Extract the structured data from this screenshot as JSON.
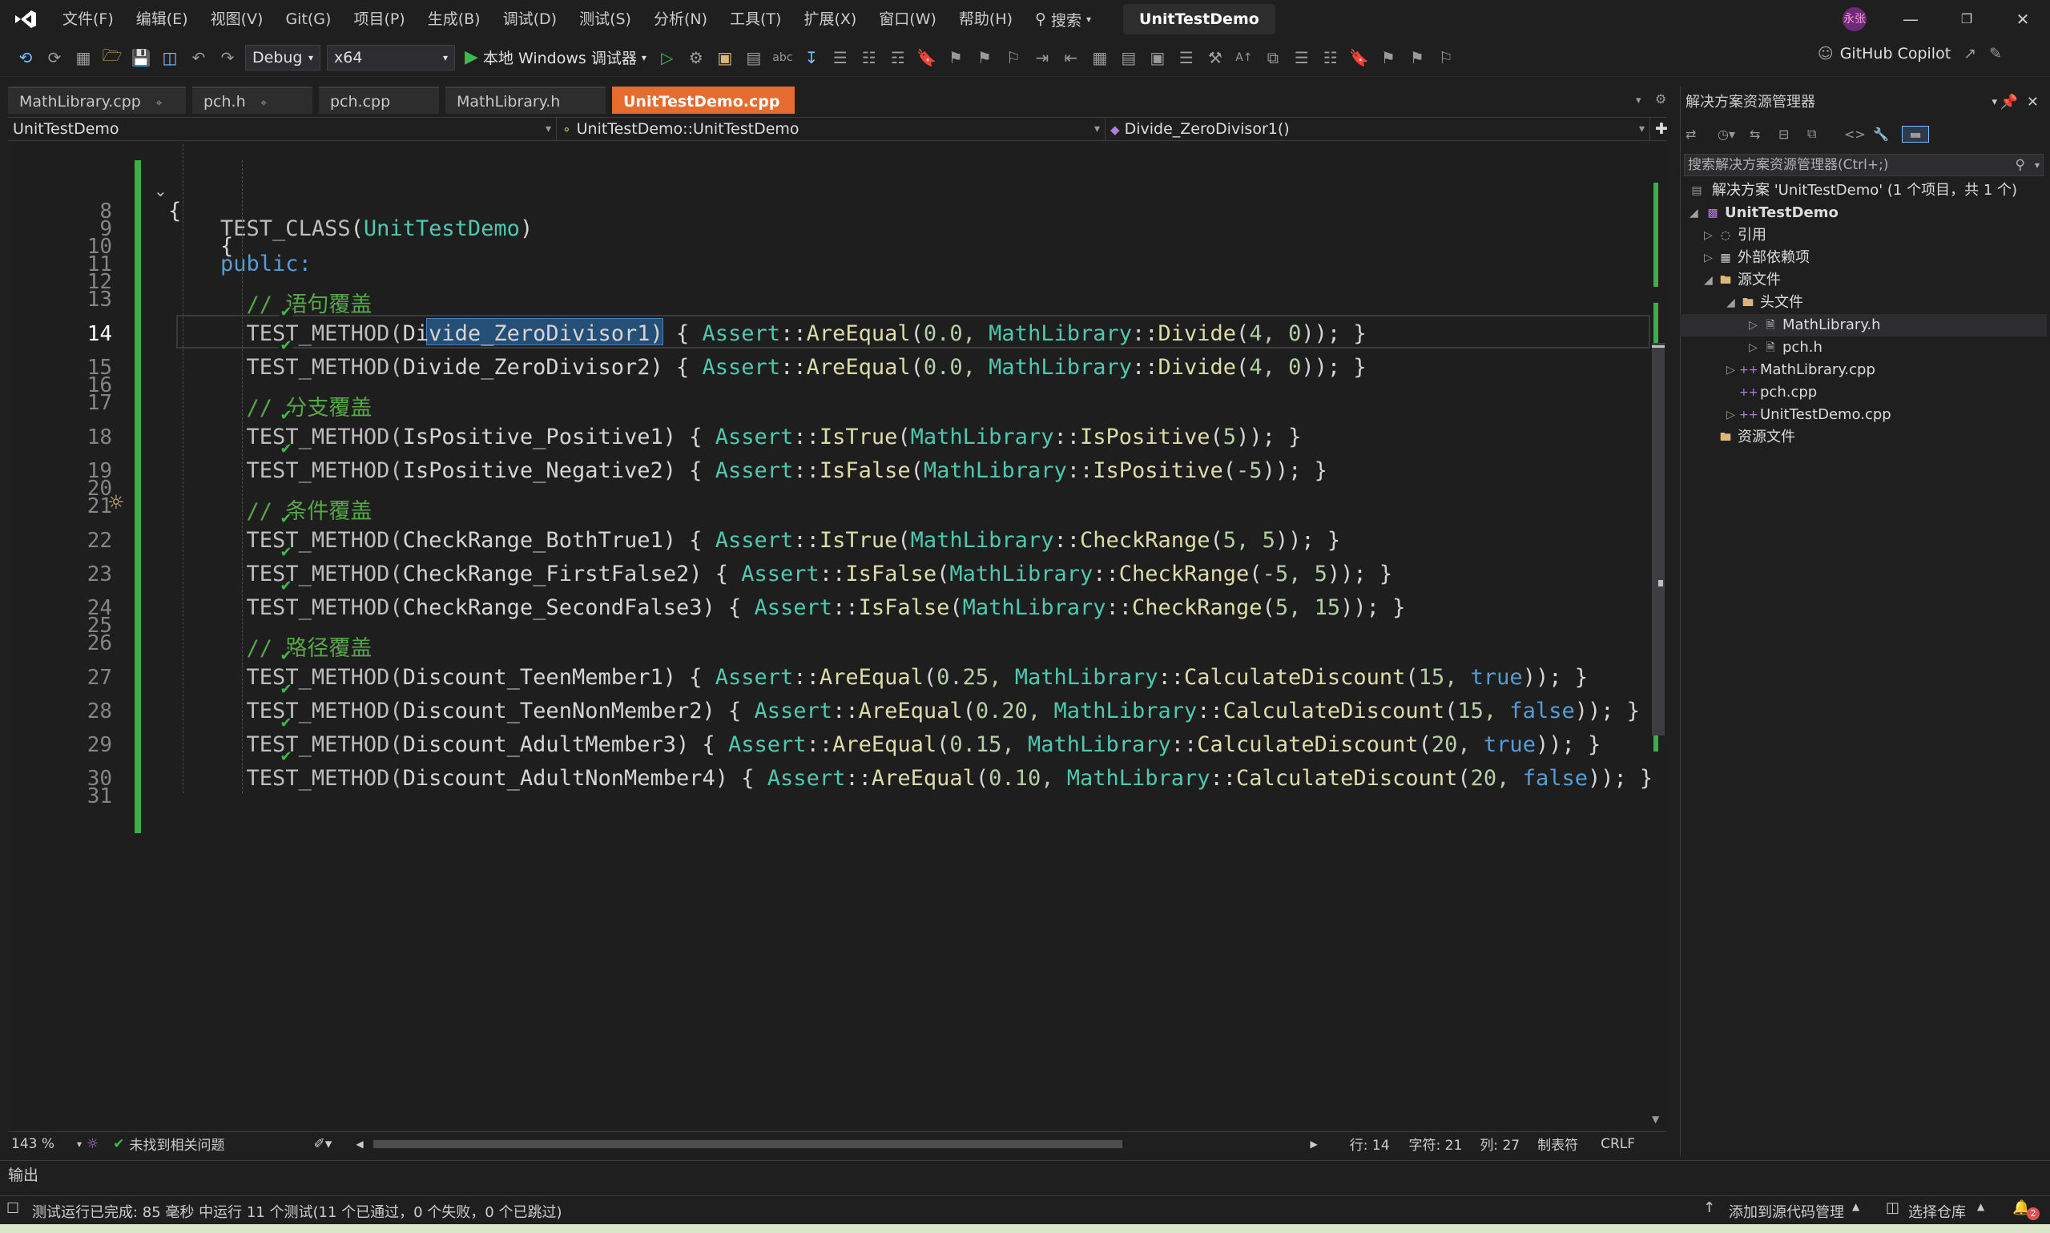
{
  "menubar": {
    "items": [
      "文件(F)",
      "编辑(E)",
      "视图(V)",
      "Git(G)",
      "项目(P)",
      "生成(B)",
      "调试(D)",
      "测试(S)",
      "分析(N)",
      "工具(T)",
      "扩展(X)",
      "窗口(W)",
      "帮助(H)"
    ],
    "search_label": "搜索",
    "project_name": "UnitTestDemo",
    "avatar_text": "永张"
  },
  "toolbar": {
    "config": "Debug",
    "platform": "x64",
    "run_label": "本地 Windows 调试器",
    "copilot_label": "GitHub Copilot"
  },
  "tabs": [
    "MathLibrary.cpp",
    "pch.h",
    "pch.cpp",
    "MathLibrary.h",
    "UnitTestDemo.cpp"
  ],
  "active_tab": "UnitTestDemo.cpp",
  "navbar": {
    "project": "UnitTestDemo",
    "scope": "UnitTestDemo::UnitTestDemo",
    "member": "Divide_ZeroDivisor1()"
  },
  "editor": {
    "line_numbers": [
      "8",
      "9",
      "10",
      "11",
      "12",
      "13",
      "14",
      "15",
      "16",
      "17",
      "18",
      "19",
      "20",
      "21",
      "22",
      "23",
      "24",
      "25",
      "26",
      "27",
      "28",
      "29",
      "30",
      "31"
    ],
    "lines": {
      "l8": "{",
      "l9_macro": "TEST_CLASS",
      "l9_name": "UnitTestDemo",
      "l10": "{",
      "l11": "public:",
      "c13": "// 语句覆盖",
      "c17": "// 分支覆盖",
      "c21": "// 条件覆盖",
      "c26": "// 路径覆盖"
    },
    "tests": [
      {
        "ln": "14",
        "name": "Divide_ZeroDivisor1",
        "assert": "AreEqual",
        "pre": "0.0, ",
        "fn": "Divide",
        "args": "4, 0"
      },
      {
        "ln": "15",
        "name": "Divide_ZeroDivisor2",
        "assert": "AreEqual",
        "pre": "0.0, ",
        "fn": "Divide",
        "args": "4, 0"
      },
      {
        "ln": "18",
        "name": "IsPositive_Positive1",
        "assert": "IsTrue",
        "pre": "",
        "fn": "IsPositive",
        "args": "5"
      },
      {
        "ln": "19",
        "name": "IsPositive_Negative2",
        "assert": "IsFalse",
        "pre": "",
        "fn": "IsPositive",
        "args": "-5"
      },
      {
        "ln": "22",
        "name": "CheckRange_BothTrue1",
        "assert": "IsTrue",
        "pre": "",
        "fn": "CheckRange",
        "args": "5, 5"
      },
      {
        "ln": "23",
        "name": "CheckRange_FirstFalse2",
        "assert": "IsFalse",
        "pre": "",
        "fn": "CheckRange",
        "args": "-5, 5"
      },
      {
        "ln": "24",
        "name": "CheckRange_SecondFalse3",
        "assert": "IsFalse",
        "pre": "",
        "fn": "CheckRange",
        "args": "5, 15"
      },
      {
        "ln": "27",
        "name": "Discount_TeenMember1",
        "assert": "AreEqual",
        "pre": "0.25, ",
        "fn": "CalculateDiscount",
        "args": "15, ",
        "bool": "true"
      },
      {
        "ln": "28",
        "name": "Discount_TeenNonMember2",
        "assert": "AreEqual",
        "pre": "0.20, ",
        "fn": "CalculateDiscount",
        "args": "15, ",
        "bool": "false"
      },
      {
        "ln": "29",
        "name": "Discount_AdultMember3",
        "assert": "AreEqual",
        "pre": "0.15, ",
        "fn": "CalculateDiscount",
        "args": "20, ",
        "bool": "true"
      },
      {
        "ln": "30",
        "name": "Discount_AdultNonMember4",
        "assert": "AreEqual",
        "pre": "0.10, ",
        "fn": "CalculateDiscount",
        "args": "20, ",
        "bool": "false"
      }
    ]
  },
  "editor_status": {
    "zoom": "143 %",
    "issues": "未找到相关问题",
    "row": "行: 14",
    "char": "字符: 21",
    "col": "列: 27",
    "tabs": "制表符",
    "eol": "CRLF"
  },
  "solution_explorer": {
    "title": "解决方案资源管理器",
    "search_placeholder": "搜索解决方案资源管理器(Ctrl+;)",
    "solution": "解决方案 'UnitTestDemo' (1 个项目，共 1 个)",
    "project": "UnitTestDemo",
    "references": "引用",
    "external": "外部依赖项",
    "source": "源文件",
    "headers": "头文件",
    "h1": "MathLibrary.h",
    "h2": "pch.h",
    "s1": "MathLibrary.cpp",
    "s2": "pch.cpp",
    "s3": "UnitTestDemo.cpp",
    "resources": "资源文件"
  },
  "output_label": "输出",
  "bottom": {
    "test_status": "测试运行已完成: 85 毫秒 中运行 11 个测试(11 个已通过，0 个失败，0 个已跳过)",
    "source_control": "添加到源代码管理",
    "repo": "选择仓库",
    "notif_count": "2"
  },
  "colors": {
    "accent_tab": "#e56b2f",
    "keyword": "#569cd6",
    "type": "#4ec9b0",
    "function": "#dcdcaa",
    "number": "#b5cea8",
    "comment": "#57a64a",
    "pass": "#3fb950"
  }
}
